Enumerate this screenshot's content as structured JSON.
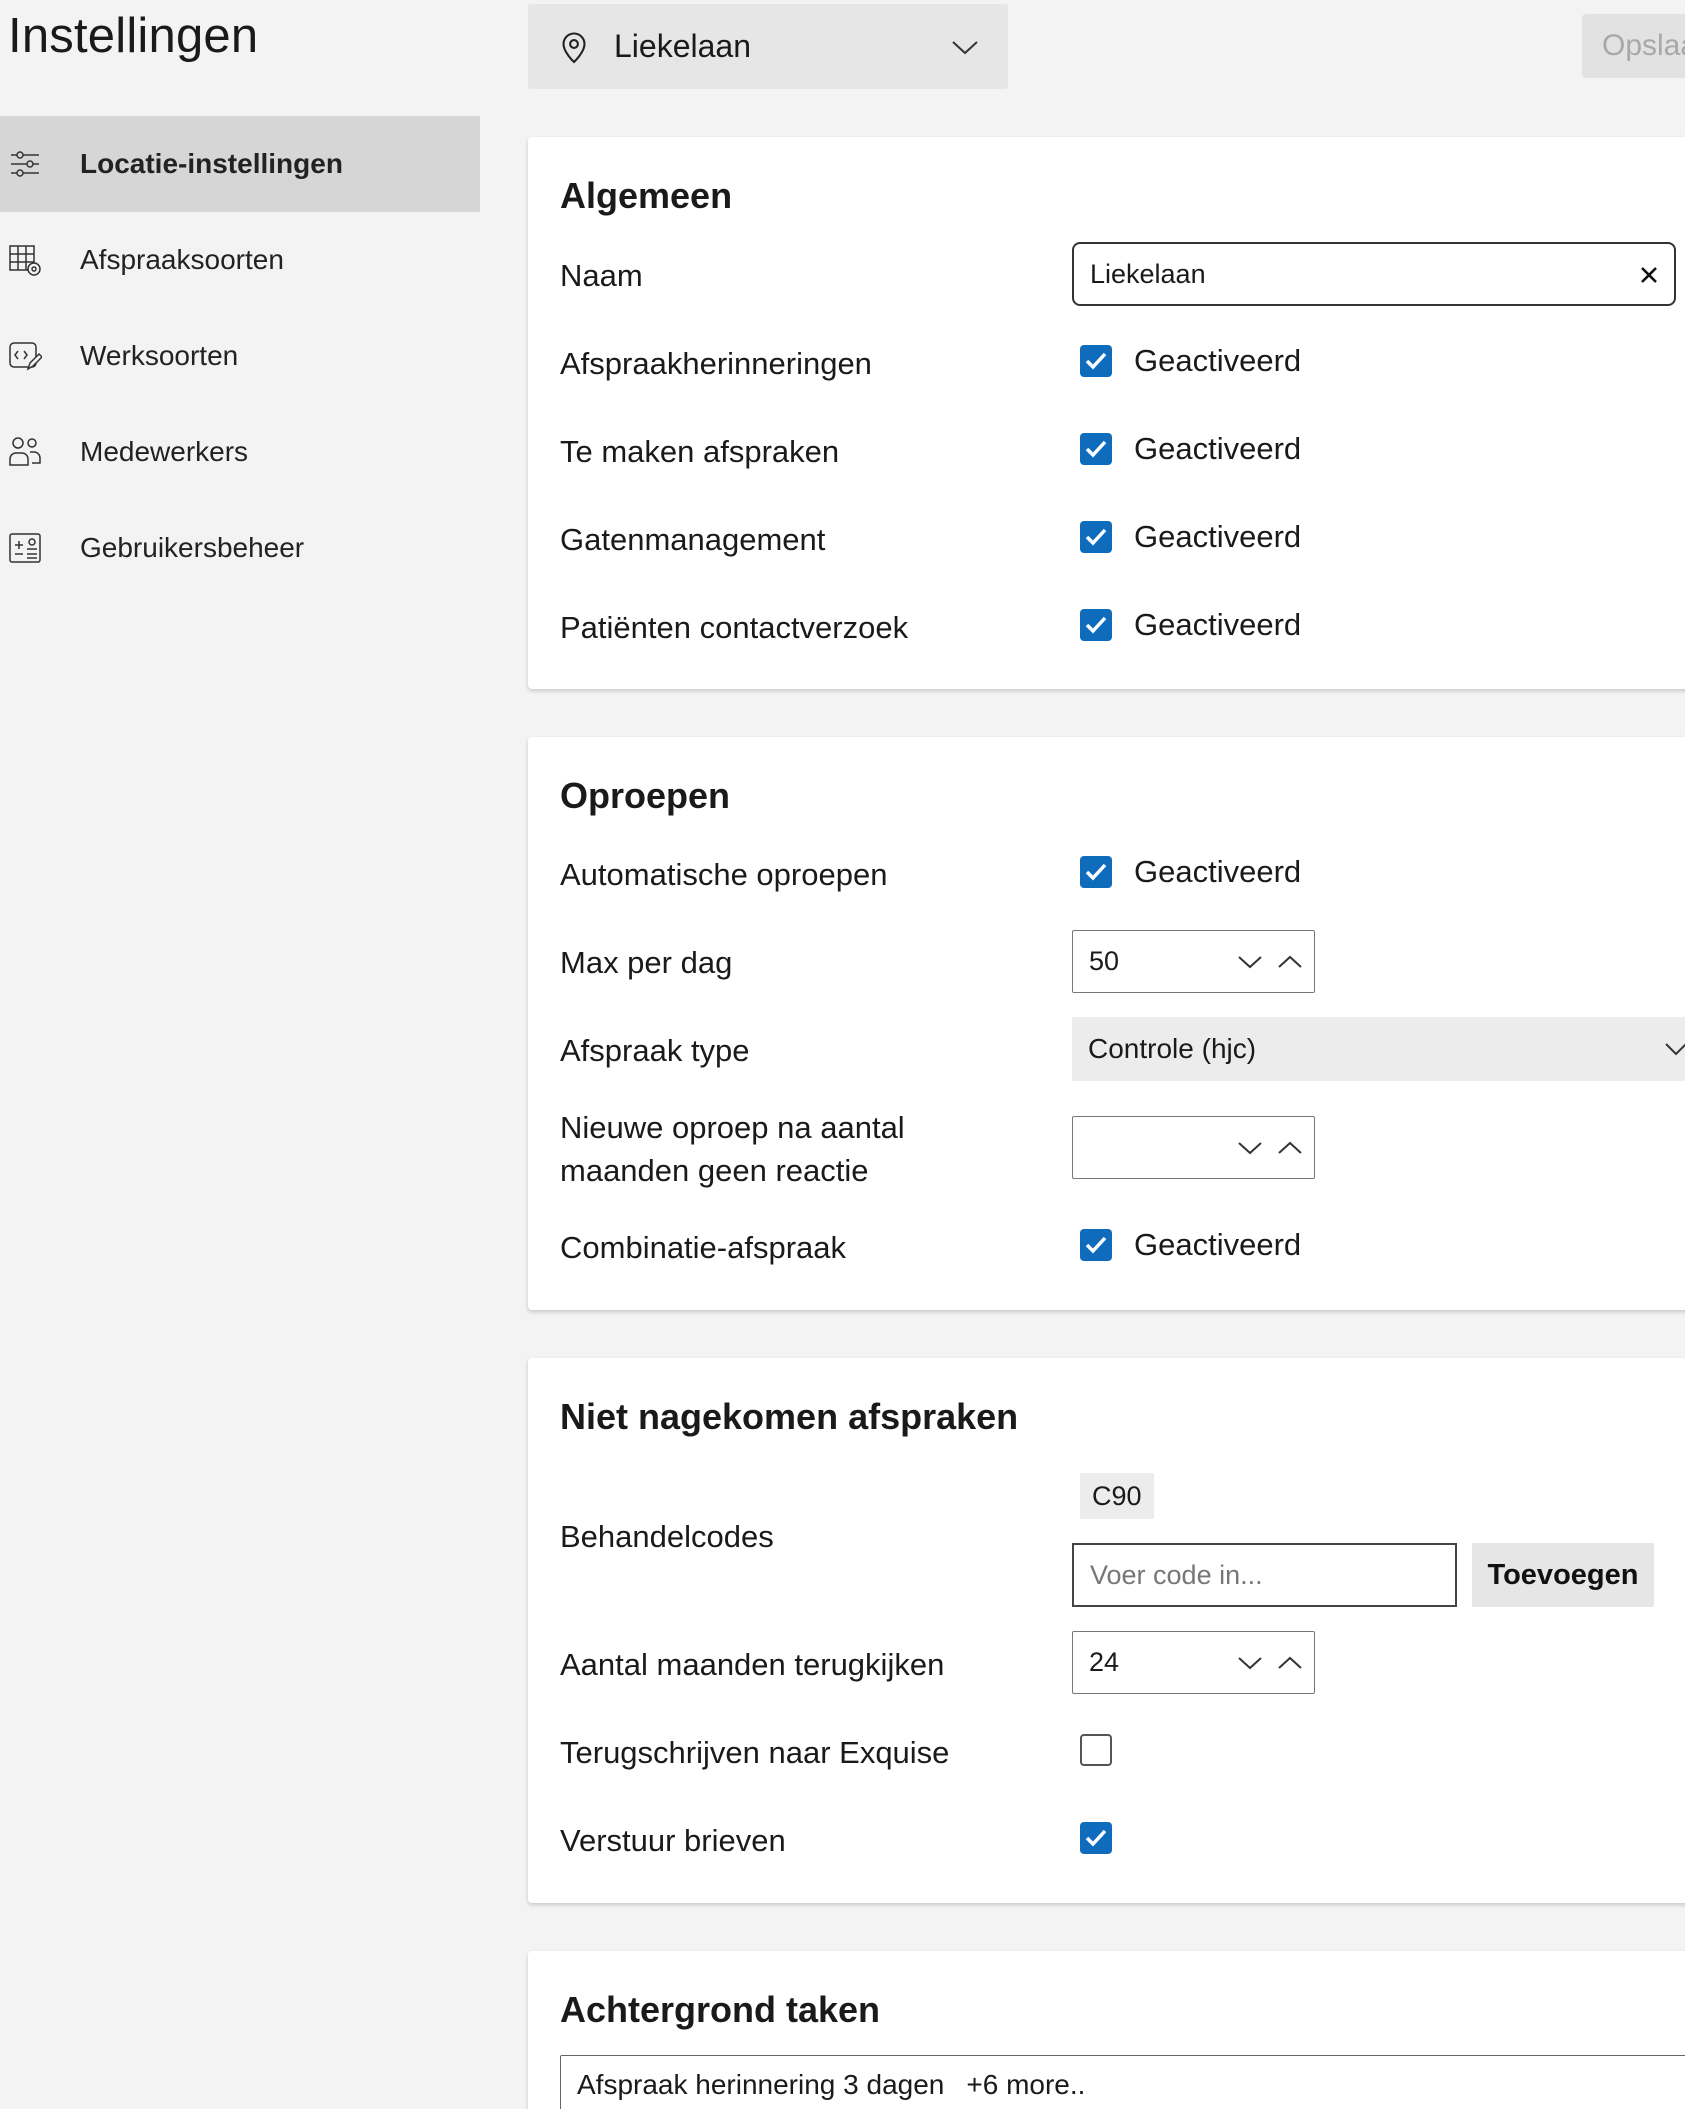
{
  "page_title": "Instellingen",
  "location_select": {
    "value": "Liekelaan",
    "icon": "location-pin-icon"
  },
  "save_button": "Opslaan",
  "sidebar": {
    "items": [
      {
        "label": "Locatie-instellingen",
        "icon": "sliders-icon",
        "active": true
      },
      {
        "label": "Afspraaksoorten",
        "icon": "table-settings-icon",
        "active": false
      },
      {
        "label": "Werksoorten",
        "icon": "code-edit-icon",
        "active": false
      },
      {
        "label": "Medewerkers",
        "icon": "people-icon",
        "active": false
      },
      {
        "label": "Gebruikersbeheer",
        "icon": "user-list-icon",
        "active": false
      }
    ]
  },
  "algemeen": {
    "title": "Algemeen",
    "naam_label": "Naam",
    "naam_value": "Liekelaan",
    "rows": [
      {
        "label": "Afspraakherinneringen",
        "checked": true,
        "status": "Geactiveerd"
      },
      {
        "label": "Te maken afspraken",
        "checked": true,
        "status": "Geactiveerd"
      },
      {
        "label": "Gatenmanagement",
        "checked": true,
        "status": "Geactiveerd"
      },
      {
        "label": "Patiënten contactverzoek",
        "checked": true,
        "status": "Geactiveerd"
      }
    ]
  },
  "oproepen": {
    "title": "Oproepen",
    "auto_label": "Automatische oproepen",
    "auto_status": "Geactiveerd",
    "max_label": "Max per dag",
    "max_value": "50",
    "type_label": "Afspraak type",
    "type_value": "Controle (hjc)",
    "nieuwe_label_1": "Nieuwe oproep na aantal",
    "nieuwe_label_2": "maanden geen reactie",
    "nieuwe_value": "",
    "combi_label": "Combinatie-afspraak",
    "combi_status": "Geactiveerd"
  },
  "niet_nagekomen": {
    "title": "Niet nagekomen afspraken",
    "codes_label": "Behandelcodes",
    "codes": [
      "C90"
    ],
    "code_placeholder": "Voer code in...",
    "add_label": "Toevoegen",
    "maanden_label": "Aantal maanden terugkijken",
    "maanden_value": "24",
    "terug_label": "Terugschrijven naar Exquise",
    "terug_checked": false,
    "brieven_label": "Verstuur brieven",
    "brieven_checked": true
  },
  "achtergrond": {
    "title": "Achtergrond taken",
    "selected": "Afspraak herinnering 3 dagen",
    "more": "+6 more.."
  },
  "colors": {
    "accent": "#0f6cbd",
    "active_nav": "#d6d6d6",
    "page_bg": "#f3f3f3"
  }
}
